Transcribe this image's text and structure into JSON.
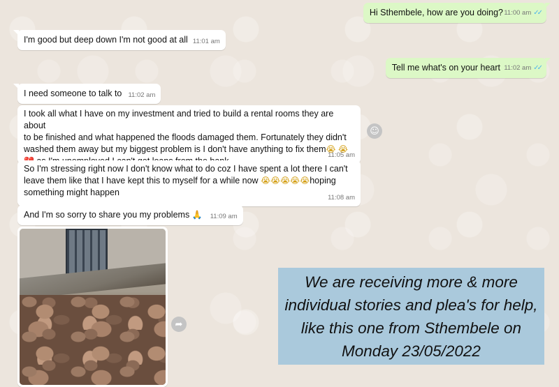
{
  "chat": {
    "messages": [
      {
        "id": "m1",
        "dir": "out",
        "text": "Hi Sthembele, how are you doing?",
        "time": "11:00 am",
        "ticks": "✓✓"
      },
      {
        "id": "m2",
        "dir": "in",
        "text": "I'm good but deep down I'm not good at all",
        "time": "11:01 am"
      },
      {
        "id": "m3",
        "dir": "out",
        "text": "Tell me what's on your heart",
        "time": "11:02 am",
        "ticks": "✓✓"
      },
      {
        "id": "m4",
        "dir": "in",
        "text": "I need someone to talk to",
        "time": "11:02 am"
      },
      {
        "id": "m5",
        "dir": "in",
        "line1": "I took all what I have on my investment and tried to build a rental rooms  they are about",
        "line2": "to be finished and what happened the floods damaged them. Fortunately they didn't",
        "line3a": "washed them away but my biggest problem is I don't have anything to fix them",
        "line4": "  as I'm unemployed I can't get loans  from the bank",
        "time": "11:05 am"
      },
      {
        "id": "m6",
        "dir": "in",
        "line1": "So I'm stressing right now I don't know what to do coz I have spent a lot there I can't",
        "line2a": "leave them like that  I have kept this to myself for a while now ",
        "line2b": "hoping",
        "line3": "something might happen",
        "time": "11:08 am"
      },
      {
        "id": "m7",
        "dir": "in",
        "text": "And  I'm so sorry to share you my problems ",
        "time": "11:09 am"
      }
    ],
    "emojis": {
      "cry": "😭",
      "heart": "💔",
      "hands": "🙏"
    },
    "icons": {
      "react": "☺",
      "forward": "➦"
    }
  },
  "notice": {
    "line1": "We are receiving more & more",
    "line2": "individual stories and plea's for help,",
    "line3": "like this one from Sthembele on",
    "line4": "Monday 23/05/2022"
  }
}
